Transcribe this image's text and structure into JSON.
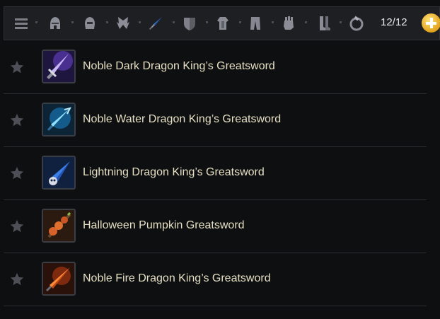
{
  "toolbar": {
    "slot_icons": [
      "menu-icon",
      "helmet-icon",
      "helm-dark-icon",
      "wings-icon",
      "sword-icon",
      "shield-icon",
      "armor-icon",
      "pants-icon",
      "gloves-icon",
      "boots-icon",
      "ring-icon"
    ],
    "count_label": "12/12",
    "add_color": "#e8a620"
  },
  "items": [
    {
      "name": "Noble Dark Dragon King’s Greatsword",
      "icon": "dark-dragon-greatsword-icon",
      "color": "#7a4cd8"
    },
    {
      "name": "Noble Water Dragon King’s Greatsword",
      "icon": "water-dragon-greatsword-icon",
      "color": "#2ea2e8"
    },
    {
      "name": "Lightning Dragon King’s Greatsword",
      "icon": "lightning-dragon-greatsword-icon",
      "color": "#3a7ee8"
    },
    {
      "name": "Halloween Pumpkin Greatsword",
      "icon": "pumpkin-greatsword-icon",
      "color": "#d8632a"
    },
    {
      "name": "Noble Fire Dragon King’s Greatsword",
      "icon": "fire-dragon-greatsword-icon",
      "color": "#e0581e"
    }
  ]
}
